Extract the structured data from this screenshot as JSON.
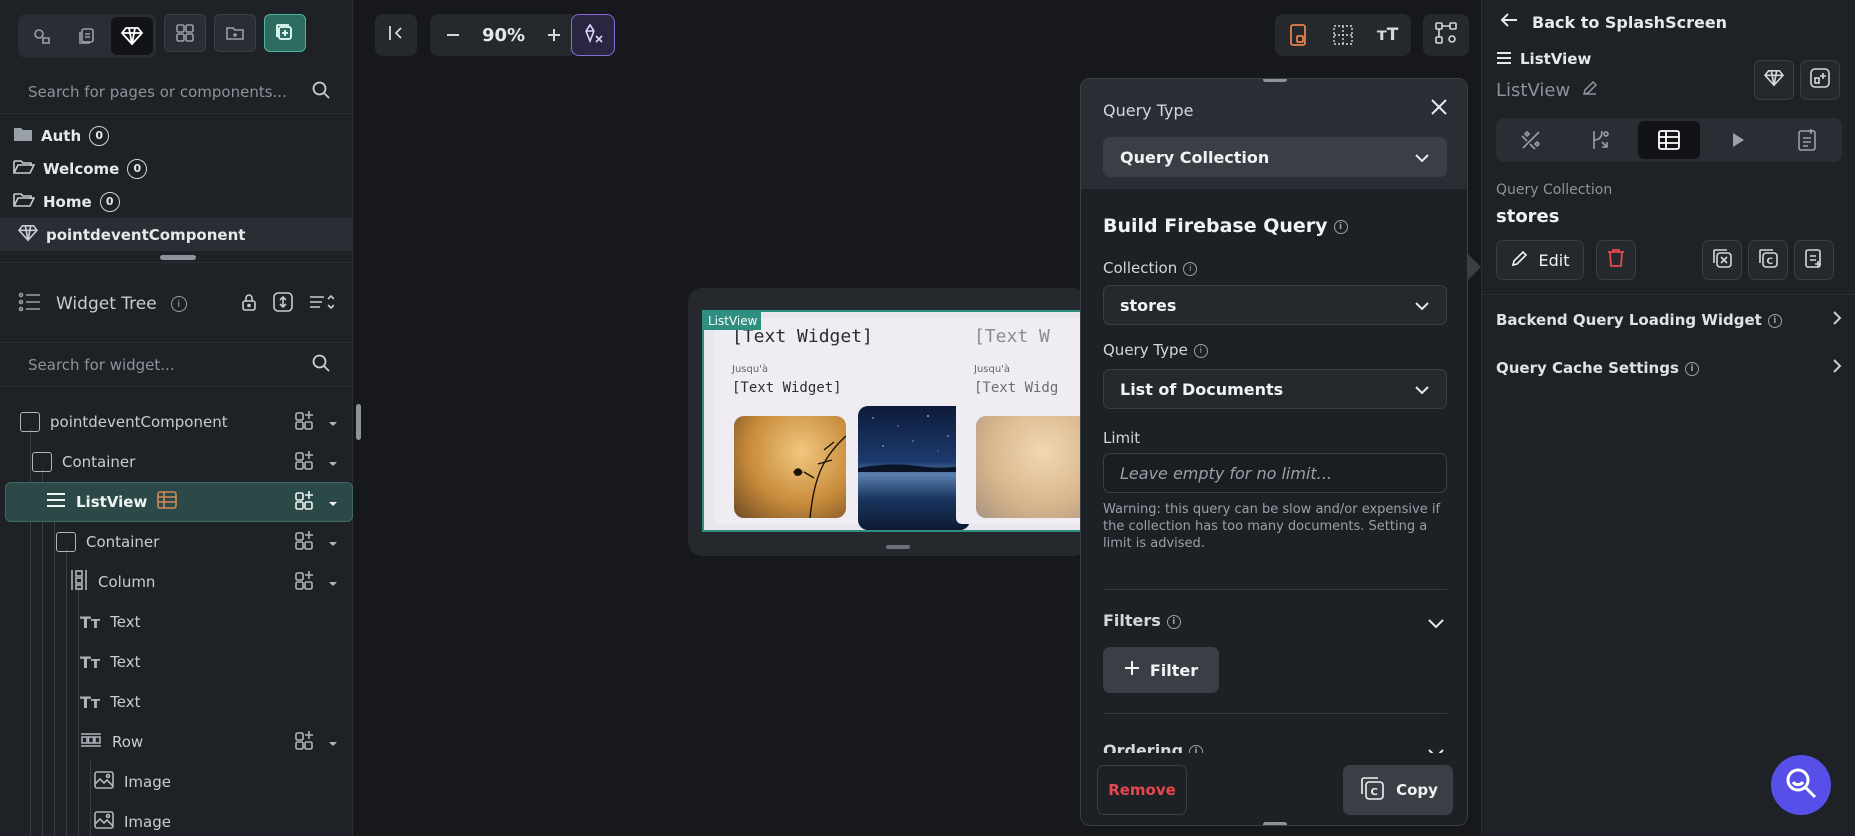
{
  "left": {
    "page_search_placeholder": "Search for pages or components...",
    "pages": [
      {
        "label": "Auth",
        "count": "0"
      },
      {
        "label": "Welcome",
        "count": "0"
      },
      {
        "label": "Home",
        "count": "0"
      }
    ],
    "component": "pointdeventComponent",
    "widget_tree_title": "Widget Tree",
    "widget_search_placeholder": "Search for widget...",
    "tree": [
      {
        "label": "pointdeventComponent"
      },
      {
        "label": "Container"
      },
      {
        "label": "ListView"
      },
      {
        "label": "Container"
      },
      {
        "label": "Column"
      },
      {
        "label": "Text"
      },
      {
        "label": "Text"
      },
      {
        "label": "Text"
      },
      {
        "label": "Row"
      },
      {
        "label": "Image"
      },
      {
        "label": "Image"
      }
    ]
  },
  "canvas": {
    "zoom": "90%",
    "preview": {
      "tag": "ListView",
      "card_title": "[Text Widget]",
      "card_small": "Jusqu'à",
      "card_sub": "[Text Widget]",
      "card2_title": "[Text W",
      "card2_small": "Jusqu'à",
      "card2_sub": "[Text Widg"
    }
  },
  "popup": {
    "query_type_label": "Query Type",
    "query_type_value": "Query Collection",
    "section_title": "Build Firebase Query",
    "collection_label": "Collection",
    "collection_value": "stores",
    "query_type2_label": "Query Type",
    "query_type2_value": "List of Documents",
    "limit_label": "Limit",
    "limit_placeholder": "Leave empty for no limit...",
    "warning": "Warning: this query can be slow and/or expensive if the collection has too many documents. Setting a limit is advised.",
    "filters_label": "Filters",
    "filter_button": "Filter",
    "ordering_label": "Ordering",
    "remove_button": "Remove",
    "copy_button": "Copy"
  },
  "right": {
    "back_label": "Back to SplashScreen",
    "widget_type": "ListView",
    "widget_name": "ListView",
    "query_caption": "Query Collection",
    "query_value": "stores",
    "edit_button": "Edit",
    "rows": [
      {
        "label": "Backend Query Loading Widget"
      },
      {
        "label": "Query Cache Settings"
      }
    ]
  },
  "colors": {
    "accent_green": "#2e8f80",
    "remove_red": "#e5484d",
    "fab": "#5750e8"
  }
}
